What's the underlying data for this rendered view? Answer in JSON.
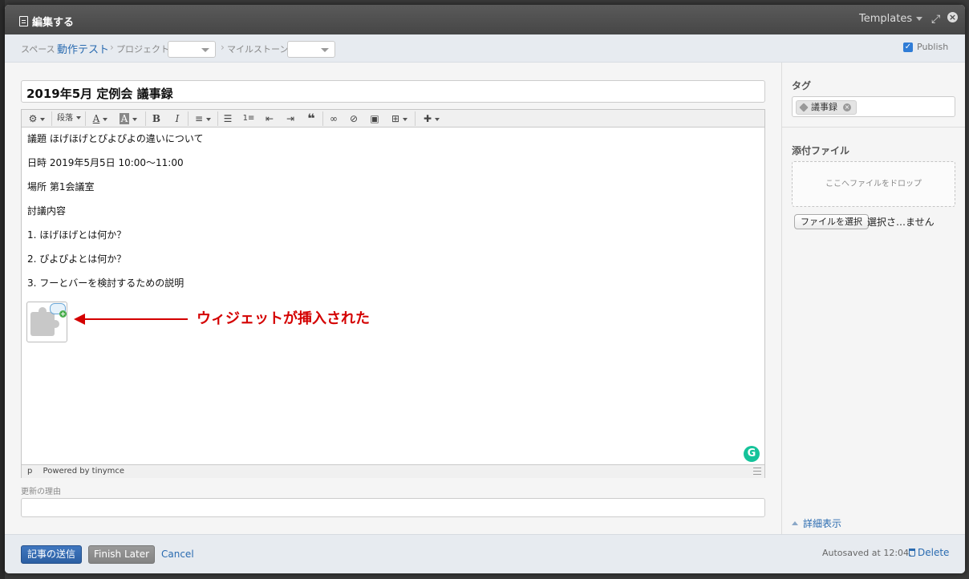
{
  "dialog": {
    "title": "編集する",
    "templates_label": "Templates"
  },
  "breadcrumb": {
    "space_label": "スペース",
    "space_value": "動作テスト",
    "project_label": "プロジェクト",
    "milestone_label": "マイルストーン",
    "publish_label": "Publish",
    "publish_checked": true
  },
  "editor": {
    "title_value": "2019年5月 定例会 議事録",
    "toolbar": {
      "paragraph_label": "段落",
      "font_color_label": "A",
      "bg_color_label": "A",
      "bold_label": "B",
      "italic_label": "I"
    },
    "content_lines": [
      "議題 ほげほげとぴよぴよの違いについて",
      "日時 2019年5月5日 10:00〜11:00",
      "場所 第1会議室",
      "討議内容",
      "1. ほげほげとは何か？",
      "2. ぴよぴよとは何か？",
      "3. フーとバーを検討するための説明"
    ],
    "annotation": "ウィジェットが挿入された",
    "status_path": "p",
    "status_powered": "Powered by tinymce",
    "grammarly_label": "G"
  },
  "update_reason": {
    "label": "更新の理由",
    "value": ""
  },
  "sidebar": {
    "tags_heading": "タグ",
    "tags": [
      "議事録"
    ],
    "attachments_heading": "添付ファイル",
    "dropzone_text": "ここへファイルをドロップ",
    "file_button_label": "ファイルを選択",
    "file_status": "選択さ…ません",
    "details_label": "詳細表示"
  },
  "footer": {
    "submit_label": "記事の送信",
    "finish_later_label": "Finish Later",
    "cancel_label": "Cancel",
    "autosave_text": "Autosaved at 12:04.",
    "delete_label": "Delete"
  },
  "colors": {
    "accent": "#2a6bb0",
    "annotation": "#d40000",
    "titlebar": "#4e4e4e",
    "grammarly": "#15c39a"
  }
}
